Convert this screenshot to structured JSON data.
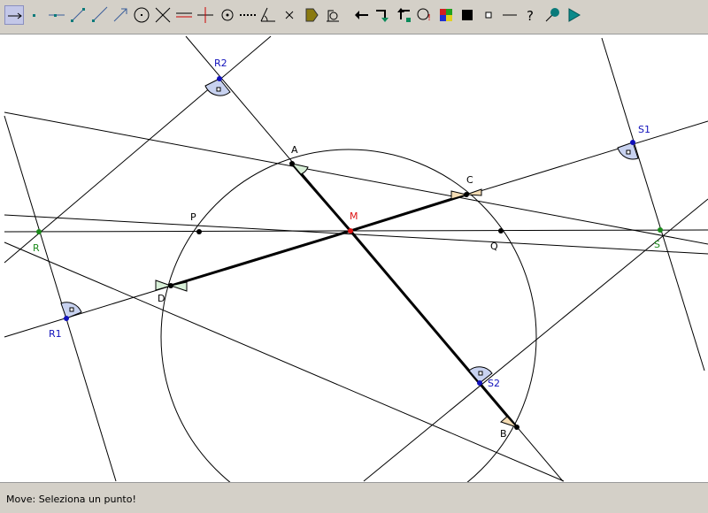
{
  "toolbar": {
    "tools": [
      "move-tool",
      "point-tool",
      "line-tool",
      "segment-tool",
      "half-line-tool",
      "vector-tool",
      "circle-tool",
      "intersection-tool",
      "parallel-tool",
      "perpendicular-tool",
      "midpoint-tool",
      "dotted-line-tool",
      "angle-tool",
      "delete-tool",
      "fill-tool",
      "measure-tool",
      "undo-tool",
      "redo-tool",
      "step-tool",
      "macro-tool",
      "color-tool",
      "black-color-tool",
      "point-style-tool",
      "line-style-tool",
      "help-tool",
      "pin-tool",
      "play-tool"
    ]
  },
  "colors": {
    "points": "#000000",
    "special_points": "#1a8a1a",
    "center": "#dd1111",
    "marker_points": "#1111bb",
    "marker_fill": "#c8d2f0",
    "angle_green": "#d8f0d8",
    "angle_orange": "#f4dcb4",
    "canvas": "#ffffff",
    "chrome": "#d4d0c8"
  },
  "figure": {
    "points": {
      "R2": "R2",
      "A": "A",
      "C": "C",
      "S1": "S1",
      "P": "P",
      "M": "M",
      "Q": "Q",
      "R": "R",
      "S": "S",
      "D": "D",
      "R1": "R1",
      "S2": "S2",
      "B": "B"
    }
  },
  "status": {
    "text": "Move: Seleziona un punto!"
  }
}
